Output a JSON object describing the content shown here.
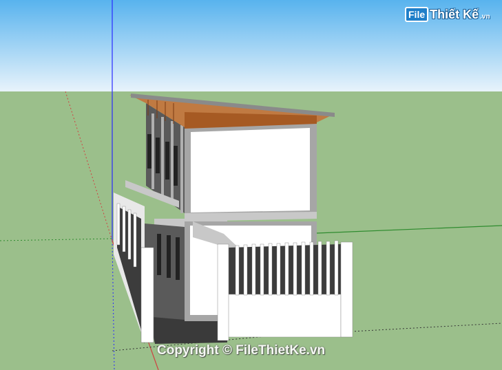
{
  "logo": {
    "box_text": "File",
    "text": "Thiết Kế",
    "suffix": ".vn"
  },
  "watermark": {
    "text": "Copyright © FileThietKe.vn"
  },
  "colors": {
    "sky_top": "#5fb9ee",
    "sky_bottom": "#e4f1fb",
    "ground": "#9bbf8b",
    "roof": "#b86a30",
    "wall": "#ffffff",
    "frame": "#a6a6a6",
    "shadow": "#3a3a3a",
    "axis_blue": "#2a2aff",
    "axis_red": "#d04040",
    "axis_green": "#2e8b2e"
  }
}
